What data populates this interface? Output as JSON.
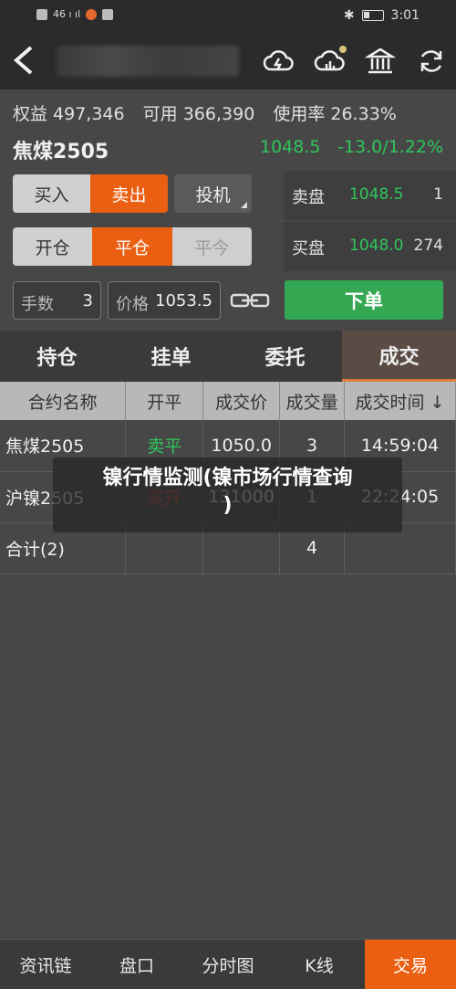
{
  "status": {
    "left": "46 ı ıl",
    "time": "3:01"
  },
  "account": {
    "equity": "权益 497,346",
    "available": "可用 366,390",
    "usage": "使用率 26.33%"
  },
  "contract": {
    "name": "焦煤2505",
    "last_price": "1048.5",
    "change": "-13.0/1.22%"
  },
  "direction": [
    "买入",
    "卖出"
  ],
  "speculation": "投机",
  "offset": [
    "开仓",
    "平仓",
    "平今"
  ],
  "quotes": {
    "ask": {
      "label": "卖盘",
      "price": "1048.5",
      "volume": "1"
    },
    "bid": {
      "label": "买盘",
      "price": "1048.0",
      "volume": "274"
    }
  },
  "qty": {
    "label": "手数",
    "value": "3"
  },
  "price_field": {
    "label": "价格",
    "value": "1053.5"
  },
  "order_button": "下单",
  "tabs": [
    "持仓",
    "挂单",
    "委托",
    "成交"
  ],
  "table": {
    "headers": [
      "合约名称",
      "开平",
      "成交价",
      "成交量",
      "成交时间 ↓"
    ],
    "rows": [
      [
        "焦煤2505",
        "卖平",
        "1050.0",
        "3",
        "14:59:04"
      ],
      [
        "沪镍2505",
        "买开",
        "131000",
        "1",
        "22:24:05"
      ],
      [
        "合计(2)",
        "",
        "",
        "4",
        ""
      ]
    ]
  },
  "watermark": {
    "line1": "镍行情监测(镍市场行情查询",
    "line2": ")"
  },
  "nav": [
    "资讯链",
    "盘口",
    "分时图",
    "K线",
    "交易"
  ],
  "colors": {
    "accent": "#ea5f12",
    "up_green": "#2fc65a",
    "down_red": "#e0423a",
    "order_green": "#34a853"
  }
}
